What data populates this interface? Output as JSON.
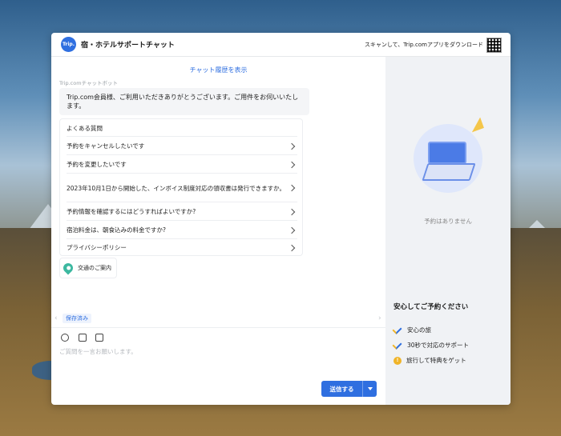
{
  "header": {
    "logo_text": "Trip.",
    "title": "宿・ホテルサポートチャット",
    "download_text": "スキャンして、Trip.comアプリをダウンロード"
  },
  "chat": {
    "history_link": "チャット履歴を表示",
    "bot_name": "Trip.comチャットボット",
    "greeting": "Trip.com会員様、ご利用いただきありがとうございます。ご用件をお伺いいたします。",
    "faq_title": "よくある質問",
    "faq_items": [
      "予約をキャンセルしたいです",
      "予約を変更したいです",
      "2023年10月1日から開始した、インボイス制度対応の領収書は発行できますか。",
      "予約情報を確認するにはどうすればよいですか?",
      "宿泊料金は、朝食込みの料金ですか?",
      "プライバシーポリシー"
    ],
    "traffic_label": "交通のご案内",
    "saved_tag": "保存済み",
    "input_placeholder": "ご質問を一言お願いします。",
    "send_label": "送信する"
  },
  "sidebar": {
    "no_reservations": "予約はありません",
    "safe_title": "安心してご予約ください",
    "features": [
      "安心の旅",
      "30秒で対応のサポート",
      "旅行して特典をゲット"
    ]
  },
  "colors": {
    "accent": "#2f6fe0",
    "sidebar_bg": "#f0f2f5",
    "gold": "#f0b428"
  }
}
